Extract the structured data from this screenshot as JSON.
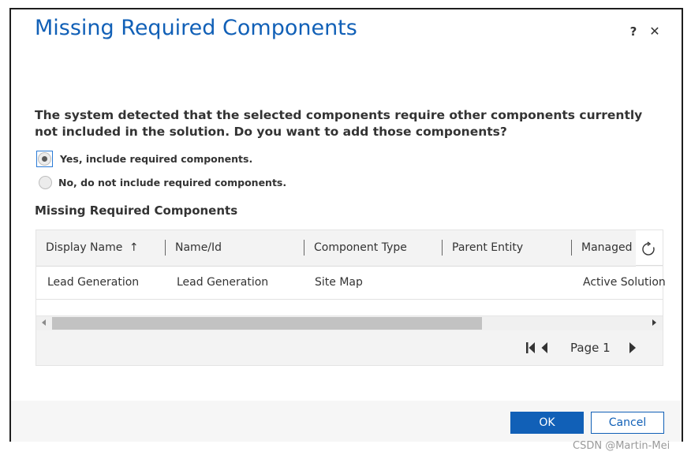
{
  "dialog": {
    "title": "Missing Required Components",
    "help_label": "?",
    "close_label": "✕"
  },
  "prompt": {
    "question": "The system detected that the selected components require other components currently not included in the solution. Do you want to add those components?"
  },
  "options": [
    {
      "label": "Yes, include required components.",
      "selected": true
    },
    {
      "label": "No, do not include required components.",
      "selected": false
    }
  ],
  "section": {
    "title": "Missing Required Components"
  },
  "grid": {
    "columns": [
      {
        "label": "Display Name",
        "sort": "ascending"
      },
      {
        "label": "Name/Id"
      },
      {
        "label": "Component Type"
      },
      {
        "label": "Parent Entity"
      },
      {
        "label": "Managed"
      }
    ],
    "sort_icon": "↑",
    "rows": [
      {
        "display_name": "Lead Generation",
        "name_id": "Lead Generation",
        "component_type": "Site Map",
        "parent_entity": "",
        "managed": "Active Solution"
      }
    ],
    "pager": {
      "page_label": "Page 1"
    },
    "icons": {
      "refresh": "refresh-icon",
      "first_page": "first-page-icon",
      "next_page": "next-page-icon"
    }
  },
  "footer": {
    "ok_label": "OK",
    "cancel_label": "Cancel"
  },
  "colors": {
    "accent": "#1160b7",
    "text": "#333333"
  },
  "watermark": "CSDN @Martin-Mei"
}
